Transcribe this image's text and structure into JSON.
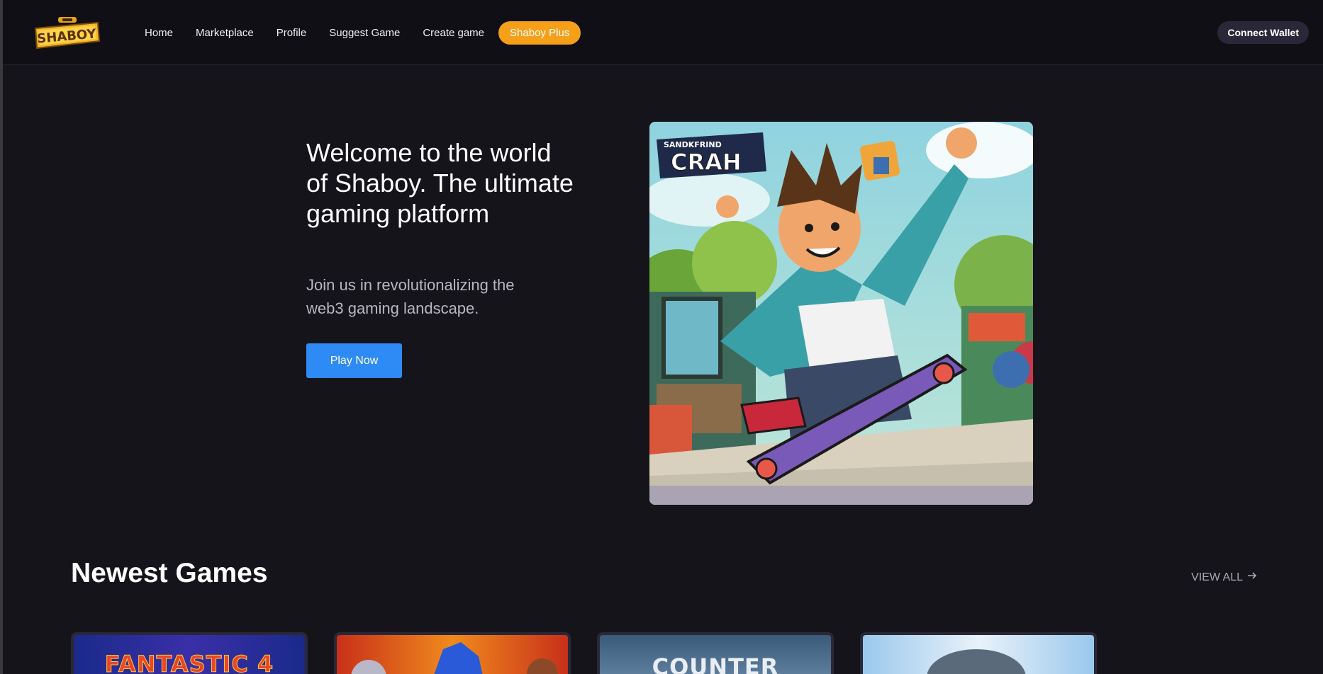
{
  "nav": {
    "logo_text": "SHABOY",
    "items": [
      {
        "label": "Home"
      },
      {
        "label": "Marketplace"
      },
      {
        "label": "Profile"
      },
      {
        "label": "Suggest Game"
      },
      {
        "label": "Create game"
      }
    ],
    "plus_label": "Shaboy Plus",
    "wallet_label": "Connect Wallet"
  },
  "hero": {
    "title": "Welcome to the world of Shaboy. The ultimate gaming platform",
    "subtitle": "Join us in revolutionalizing the web3 gaming landscape.",
    "cta_label": "Play Now",
    "image_caption": "CRAH",
    "image_caption_small": "SANDKFRIND"
  },
  "newest": {
    "title": "Newest Games",
    "view_all_label": "VIEW ALL",
    "view_all_icon": "arrow-right-icon",
    "cards": [
      {
        "title": "FANTASTIC 4",
        "accent": "#e8452a"
      },
      {
        "title": "",
        "accent": "#f08a1c"
      },
      {
        "title": "COUNTER",
        "accent": "#e9eef5"
      },
      {
        "title": "",
        "accent": "#b7d6f0"
      }
    ]
  },
  "colors": {
    "background": "#16141b",
    "header": "#100f15",
    "plus_accent": "#f6a01a",
    "cta_blue": "#2e8bf5"
  }
}
